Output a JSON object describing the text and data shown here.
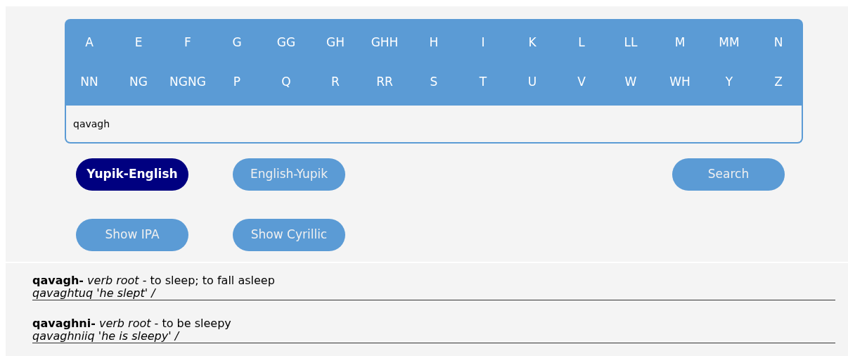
{
  "keyboard": {
    "rows": [
      [
        "A",
        "E",
        "F",
        "G",
        "GG",
        "GH",
        "GHH",
        "H",
        "I",
        "K",
        "L",
        "LL",
        "M",
        "MM",
        "N"
      ],
      [
        "NN",
        "NG",
        "NGNG",
        "P",
        "Q",
        "R",
        "RR",
        "S",
        "T",
        "U",
        "V",
        "W",
        "WH",
        "Y",
        "Z"
      ]
    ]
  },
  "search": {
    "value": "qavagh"
  },
  "modes": [
    {
      "label": "Yupik-English",
      "selected": true
    },
    {
      "label": "English-Yupik",
      "selected": false
    }
  ],
  "search_button": "Search",
  "toggles": [
    {
      "label": "Show IPA",
      "on": false
    },
    {
      "label": "Show Cyrillic",
      "on": false
    }
  ],
  "results": [
    {
      "definition": "**qavagh-** *verb root* - to sleep; to fall asleep",
      "example": "qavaghtuq 'he slept' /"
    },
    {
      "definition": "**qavaghni-** *verb root* - to be sleepy",
      "example": "qavaghniiq 'he is sleepy' /"
    }
  ]
}
